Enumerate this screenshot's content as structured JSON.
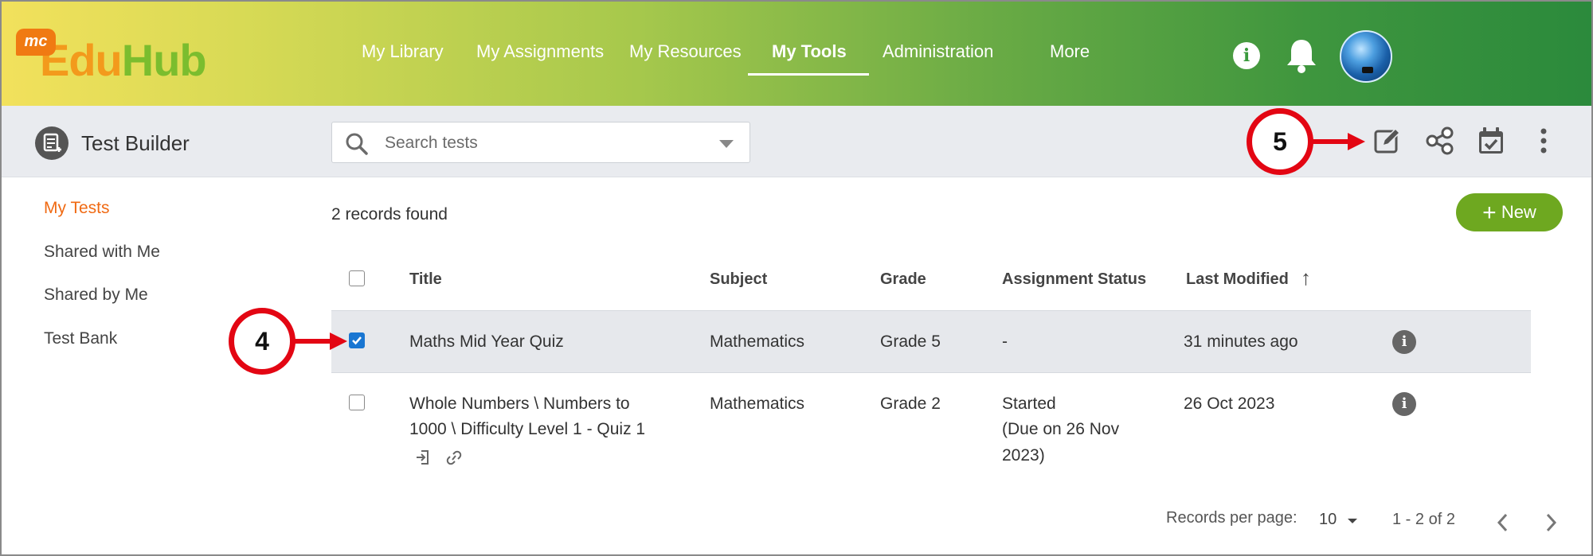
{
  "brand": {
    "badge": "mc",
    "name_part1": "Edu",
    "name_part2": "Hub"
  },
  "nav": {
    "items": [
      "My Library",
      "My Assignments",
      "My Resources",
      "My Tools",
      "Administration",
      "More"
    ],
    "active": "My Tools"
  },
  "header_icons": [
    "info-icon",
    "bell-icon",
    "avatar"
  ],
  "toolbar": {
    "title": "Test Builder",
    "search_placeholder": "Search tests",
    "actions": [
      "edit-icon",
      "share-icon",
      "calendar-check-icon",
      "more-vert-icon"
    ]
  },
  "sidebar": {
    "items": [
      "My Tests",
      "Shared with Me",
      "Shared by Me",
      "Test Bank"
    ],
    "active": "My Tests"
  },
  "main": {
    "records_found": "2 records found",
    "new_button": "New",
    "columns": [
      "Title",
      "Subject",
      "Grade",
      "Assignment Status",
      "Last Modified"
    ],
    "sort_indicator": "↑",
    "rows": [
      {
        "checked": true,
        "title": "Maths Mid Year Quiz",
        "subject": "Mathematics",
        "grade": "Grade 5",
        "status": "-",
        "modified": "31 minutes ago"
      },
      {
        "checked": false,
        "title_line1": "Whole Numbers \\ Numbers to",
        "title_line2": "1000 \\ Difficulty Level 1 - Quiz 1",
        "subject": "Mathematics",
        "grade": "Grade 2",
        "status_line1": "Started",
        "status_line2": "(Due on 26 Nov",
        "status_line3": "2023)",
        "modified": "26 Oct 2023"
      }
    ]
  },
  "pagination": {
    "rpp_label": "Records per page:",
    "rpp_value": "10",
    "range": "1 - 2 of 2"
  },
  "annotations": {
    "step4": "4",
    "step5": "5"
  },
  "colors": {
    "accent_orange": "#f06a13",
    "new_button_green": "#6ea820",
    "annotation_red": "#e30613",
    "checkbox_blue": "#1976d2"
  }
}
